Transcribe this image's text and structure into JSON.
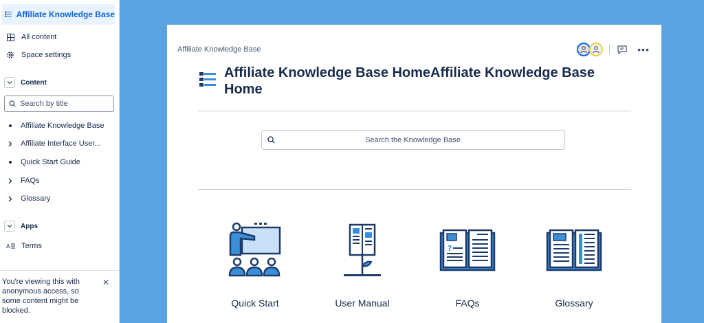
{
  "sidebar": {
    "space_title": "Affiliate Knowledge Base",
    "nav": [
      {
        "label": "All content",
        "icon": "grid-icon"
      },
      {
        "label": "Space settings",
        "icon": "gear-icon"
      }
    ],
    "content_section": "Content",
    "search_placeholder": "Search by title",
    "tree": [
      {
        "label": "Affiliate Knowledge Base",
        "marker": "bullet"
      },
      {
        "label": "Affiliate Interface User...",
        "marker": "chevron-right"
      },
      {
        "label": "Quick Start Guide",
        "marker": "bullet"
      },
      {
        "label": "FAQs",
        "marker": "chevron-right"
      },
      {
        "label": "Glossary",
        "marker": "chevron-right"
      }
    ],
    "apps_section": "Apps",
    "apps": [
      {
        "label": "Terms",
        "icon": "terms-icon"
      }
    ],
    "notice": "You're viewing this with anonymous access, so some content might be blocked."
  },
  "page": {
    "breadcrumb": "Affiliate Knowledge Base",
    "title": "Affiliate Knowledge Base HomeAffiliate Knowledge Base Home",
    "search_placeholder": "Search the Knowledge Base",
    "tiles": [
      {
        "label": "Quick Start",
        "icon": "presenter-icon"
      },
      {
        "label": "User Manual",
        "icon": "manual-icon"
      },
      {
        "label": "FAQs",
        "icon": "faq-book-icon"
      },
      {
        "label": "Glossary",
        "icon": "glossary-book-icon"
      }
    ]
  },
  "colors": {
    "background": "#5aa3e0",
    "accent": "#0c66e4",
    "icon_navy": "#1d3a6b",
    "icon_blue": "#3b8fd9"
  }
}
